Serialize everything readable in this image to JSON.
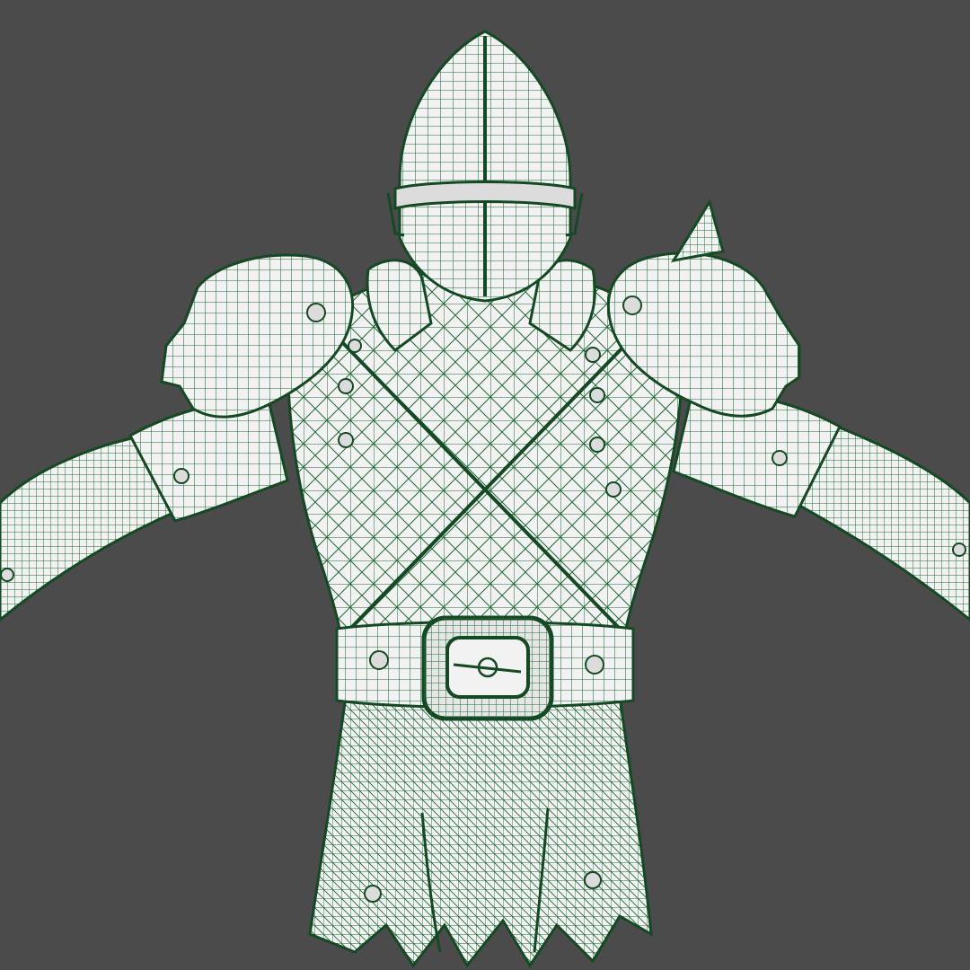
{
  "viewport": {
    "mode": "wireframe",
    "subject": "armored-knight-model",
    "colors": {
      "background": "#4b4b4b",
      "surface": "#f2f2f2",
      "surface_shade": "#d6d6d6",
      "wire": "#1f6a36",
      "wire_dark": "#134a24"
    }
  }
}
